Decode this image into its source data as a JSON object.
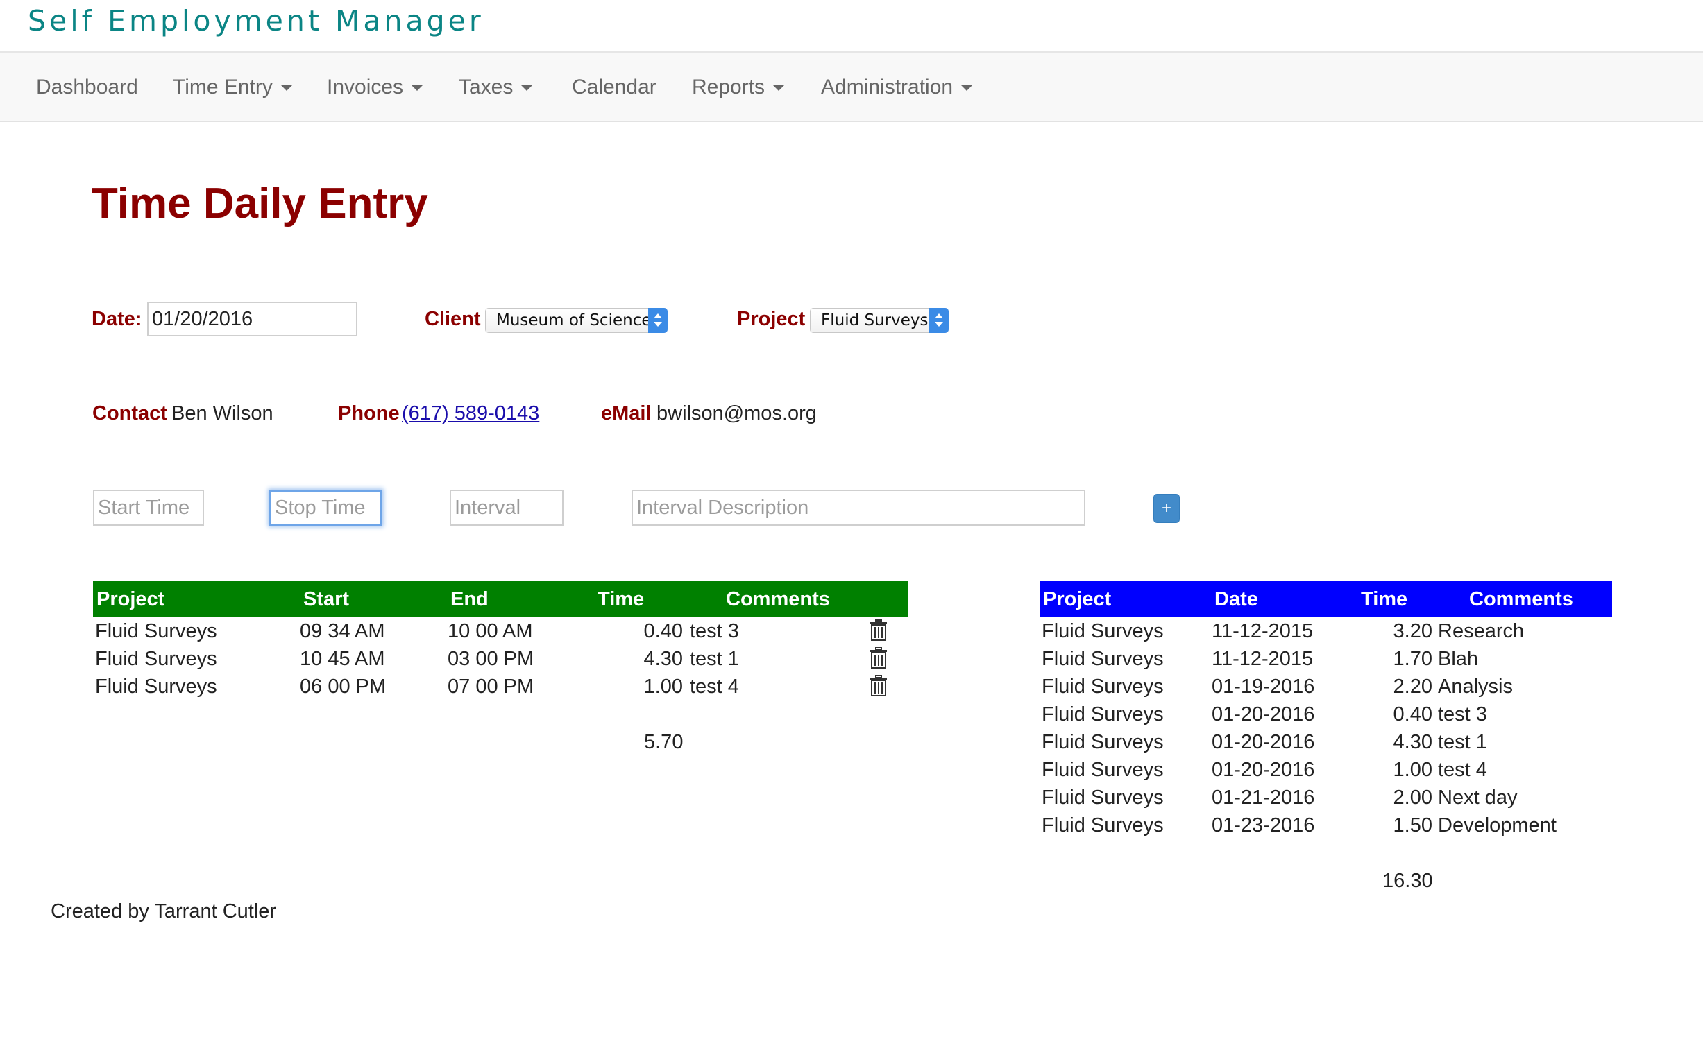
{
  "app": {
    "title": "Self Employment Manager"
  },
  "nav": {
    "dashboard": "Dashboard",
    "time_entry": "Time Entry",
    "invoices": "Invoices",
    "taxes": "Taxes",
    "calendar": "Calendar",
    "reports": "Reports",
    "administration": "Administration"
  },
  "page": {
    "title": "Time Daily Entry"
  },
  "form": {
    "date_label": "Date:",
    "date_value": "01/20/2016",
    "client_label": "Client",
    "client_value": "Museum of Science",
    "project_label": "Project",
    "project_value": "Fluid Surveys"
  },
  "contact": {
    "contact_label": "Contact",
    "contact_name": "Ben Wilson",
    "phone_label": "Phone",
    "phone_value": "(617) 589-0143",
    "email_label": "eMail",
    "email_value": "bwilson@mos.org"
  },
  "entry": {
    "start_placeholder": "Start Time",
    "stop_placeholder": "Stop Time",
    "interval_placeholder": "Interval",
    "description_placeholder": "Interval Description",
    "add_label": "+"
  },
  "daily_table": {
    "header_color": "#008000",
    "headers": {
      "project": "Project",
      "start": "Start",
      "end": "End",
      "time": "Time",
      "comments": "Comments"
    },
    "rows": [
      {
        "project": "Fluid Surveys",
        "start": "09 34 AM",
        "end": "10 00 AM",
        "time": "0.40",
        "comment": "test 3"
      },
      {
        "project": "Fluid Surveys",
        "start": "10 45 AM",
        "end": "03 00 PM",
        "time": "4.30",
        "comment": "test 1"
      },
      {
        "project": "Fluid Surveys",
        "start": "06 00 PM",
        "end": "07 00 PM",
        "time": "1.00",
        "comment": "test 4"
      }
    ],
    "row_icon": "trash-icon",
    "total": "5.70"
  },
  "history_table": {
    "header_color": "#0000ff",
    "headers": {
      "project": "Project",
      "date": "Date",
      "time": "Time",
      "comments": "Comments"
    },
    "rows": [
      {
        "project": "Fluid Surveys",
        "date": "11-12-2015",
        "time": "3.20",
        "comment": "Research"
      },
      {
        "project": "Fluid Surveys",
        "date": "11-12-2015",
        "time": "1.70",
        "comment": "Blah"
      },
      {
        "project": "Fluid Surveys",
        "date": "01-19-2016",
        "time": "2.20",
        "comment": "Analysis"
      },
      {
        "project": "Fluid Surveys",
        "date": "01-20-2016",
        "time": "0.40",
        "comment": "test 3"
      },
      {
        "project": "Fluid Surveys",
        "date": "01-20-2016",
        "time": "4.30",
        "comment": "test 1"
      },
      {
        "project": "Fluid Surveys",
        "date": "01-20-2016",
        "time": "1.00",
        "comment": "test 4"
      },
      {
        "project": "Fluid Surveys",
        "date": "01-21-2016",
        "time": "2.00",
        "comment": "Next day"
      },
      {
        "project": "Fluid Surveys",
        "date": "01-23-2016",
        "time": "1.50",
        "comment": "Development"
      }
    ],
    "total": "16.30"
  },
  "footer": {
    "text": "Created by Tarrant Cutler"
  }
}
